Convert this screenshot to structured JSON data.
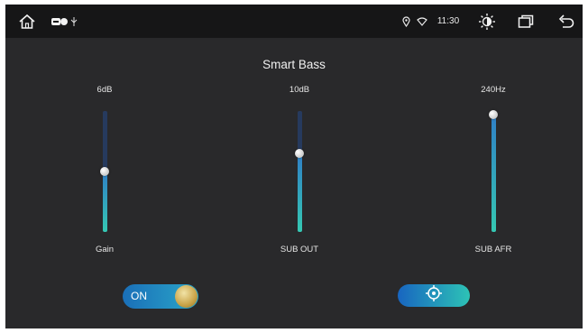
{
  "status_bar": {
    "icons": [
      "home-icon",
      "media-icon",
      "usb-icon",
      "location-icon",
      "wifi-icon",
      "brightness-icon",
      "recent-apps-icon",
      "back-icon"
    ],
    "time": "11:30"
  },
  "page": {
    "title": "Smart Bass"
  },
  "sliders": [
    {
      "name": "Gain",
      "value_label": "6dB",
      "level": 0.5
    },
    {
      "name": "SUB OUT",
      "value_label": "10dB",
      "level": 0.65
    },
    {
      "name": "SUB AFR",
      "value_label": "240Hz",
      "level": 0.97
    }
  ],
  "toggle": {
    "label": "ON",
    "state": "on"
  },
  "locate_button": {
    "icon": "crosshair-icon"
  },
  "colors": {
    "background": "#29292b",
    "status_bar": "#161617",
    "accent": "#2f7fc7",
    "fill_bottom": "#35c8b2"
  }
}
